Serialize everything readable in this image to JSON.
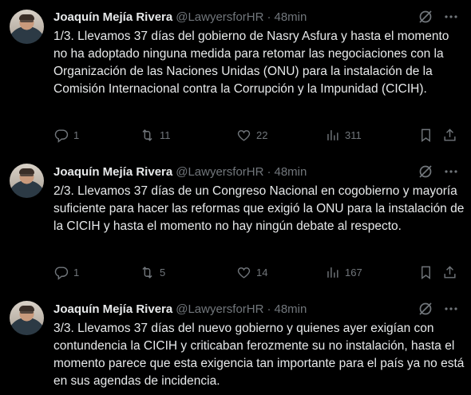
{
  "tweets": [
    {
      "author_name": "Joaquín Mejía Rivera",
      "handle": "@LawyersforHR",
      "separator": "·",
      "time": "48min",
      "text": "1/3. Llevamos 37 días del gobierno de Nasry Asfura y hasta el momento no ha adoptado ninguna medida para retomar las negociaciones con la Organización de las Naciones Unidas (ONU) para la instalación de la Comisión Internacional contra la Corrupción y la Impunidad (CICIH).",
      "replies": "1",
      "retweets": "11",
      "likes": "22",
      "views": "311"
    },
    {
      "author_name": "Joaquín Mejía Rivera",
      "handle": "@LawyersforHR",
      "separator": "·",
      "time": "48min",
      "text": "2/3. Llevamos 37 días de un Congreso Nacional en cogobierno y mayoría suficiente para hacer las reformas que exigió la ONU para la instalación de la CICIH y hasta el momento no hay ningún debate al respecto.",
      "replies": "1",
      "retweets": "5",
      "likes": "14",
      "views": "167"
    },
    {
      "author_name": "Joaquín Mejía Rivera",
      "handle": "@LawyersforHR",
      "separator": "·",
      "time": "48min",
      "text": "3/3. Llevamos 37 días del nuevo gobierno y quienes ayer exigían con contundencia la CICIH y criticaban ferozmente su no instalación, hasta el momento parece que esta exigencia tan importante para el país ya no está en sus agendas de incidencia."
    }
  ],
  "icons": {
    "reply": "reply-icon",
    "retweet": "retweet-icon",
    "like": "heart-icon",
    "views": "views-icon",
    "bookmark": "bookmark-icon",
    "share": "share-icon",
    "grok": "grok-icon",
    "more": "more-icon"
  },
  "colors": {
    "background": "#000000",
    "text": "#e7e9ea",
    "muted": "#71767b"
  }
}
